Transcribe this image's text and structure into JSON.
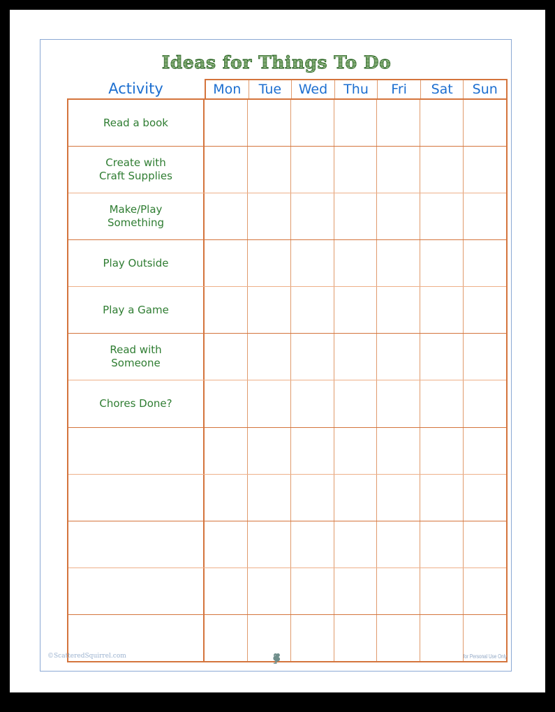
{
  "page": {
    "title": "Ideas for Things To Do"
  },
  "table": {
    "activity_header": "Activity",
    "day_headers": [
      "Mon",
      "Tue",
      "Wed",
      "Thu",
      "Fri",
      "Sat",
      "Sun"
    ],
    "rows": [
      {
        "activity": "Read a book"
      },
      {
        "activity": "Create with\nCraft Supplies"
      },
      {
        "activity": "Make/Play\nSomething"
      },
      {
        "activity": "Play Outside"
      },
      {
        "activity": "Play a Game"
      },
      {
        "activity": "Read with\nSomeone"
      },
      {
        "activity": "Chores Done?"
      },
      {
        "activity": ""
      },
      {
        "activity": ""
      },
      {
        "activity": ""
      },
      {
        "activity": ""
      },
      {
        "activity": ""
      }
    ]
  },
  "footer": {
    "copyright": "©ScatteredSquirrel.com",
    "usage": "for Personal Use Only",
    "logo_icon": "squirrel-icon"
  },
  "colors": {
    "title_green": "#3f7a34",
    "activity_green": "#2f7d32",
    "header_blue": "#1d6fd0",
    "grid_orange": "#d4743c",
    "grid_orange_light": "#e09a6c",
    "frame_blue": "#8ba8d4",
    "footer_gray_blue": "#9bb2cf"
  }
}
